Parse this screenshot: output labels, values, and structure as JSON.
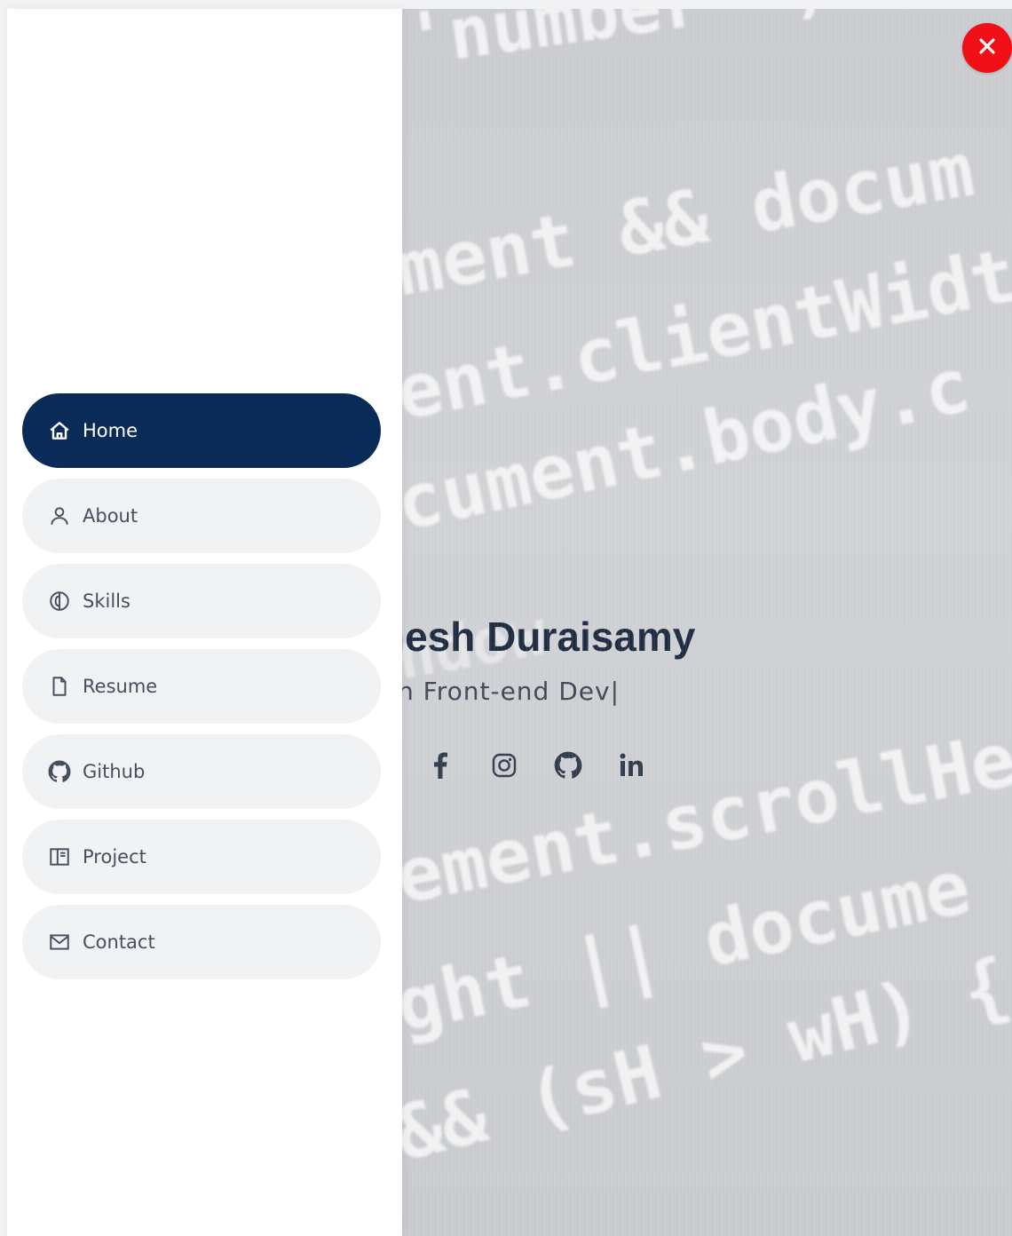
{
  "sidebar": {
    "items": [
      {
        "label": "Home",
        "icon": "home-icon",
        "active": true
      },
      {
        "label": "About",
        "icon": "user-icon",
        "active": false
      },
      {
        "label": "Skills",
        "icon": "brain-icon",
        "active": false
      },
      {
        "label": "Resume",
        "icon": "file-icon",
        "active": false
      },
      {
        "label": "Github",
        "icon": "github-icon",
        "active": false
      },
      {
        "label": "Project",
        "icon": "book-icon",
        "active": false
      },
      {
        "label": "Contact",
        "icon": "envelope-icon",
        "active": false
      }
    ]
  },
  "hero": {
    "name": "nesh Duraisamy",
    "subtitle": "n Front-end Dev",
    "caret": "|",
    "socials": [
      "facebook-icon",
      "instagram-icon",
      "github-icon",
      "linkedin-icon"
    ],
    "background_code": [
      "'number' ) {",
      "ment && docum",
      "ent.clientWidt",
      "cument.body.c",
      "ndow.",
      "ement.scrollHe",
      "ght || docume",
      "&& (sH > wH) {"
    ]
  },
  "close_button": {
    "icon": "close-icon",
    "color": "#f10f17"
  },
  "colors": {
    "active_nav": "#0a2b58",
    "nav_bg": "#f1f2f4",
    "name_text": "#1d2a3f"
  }
}
